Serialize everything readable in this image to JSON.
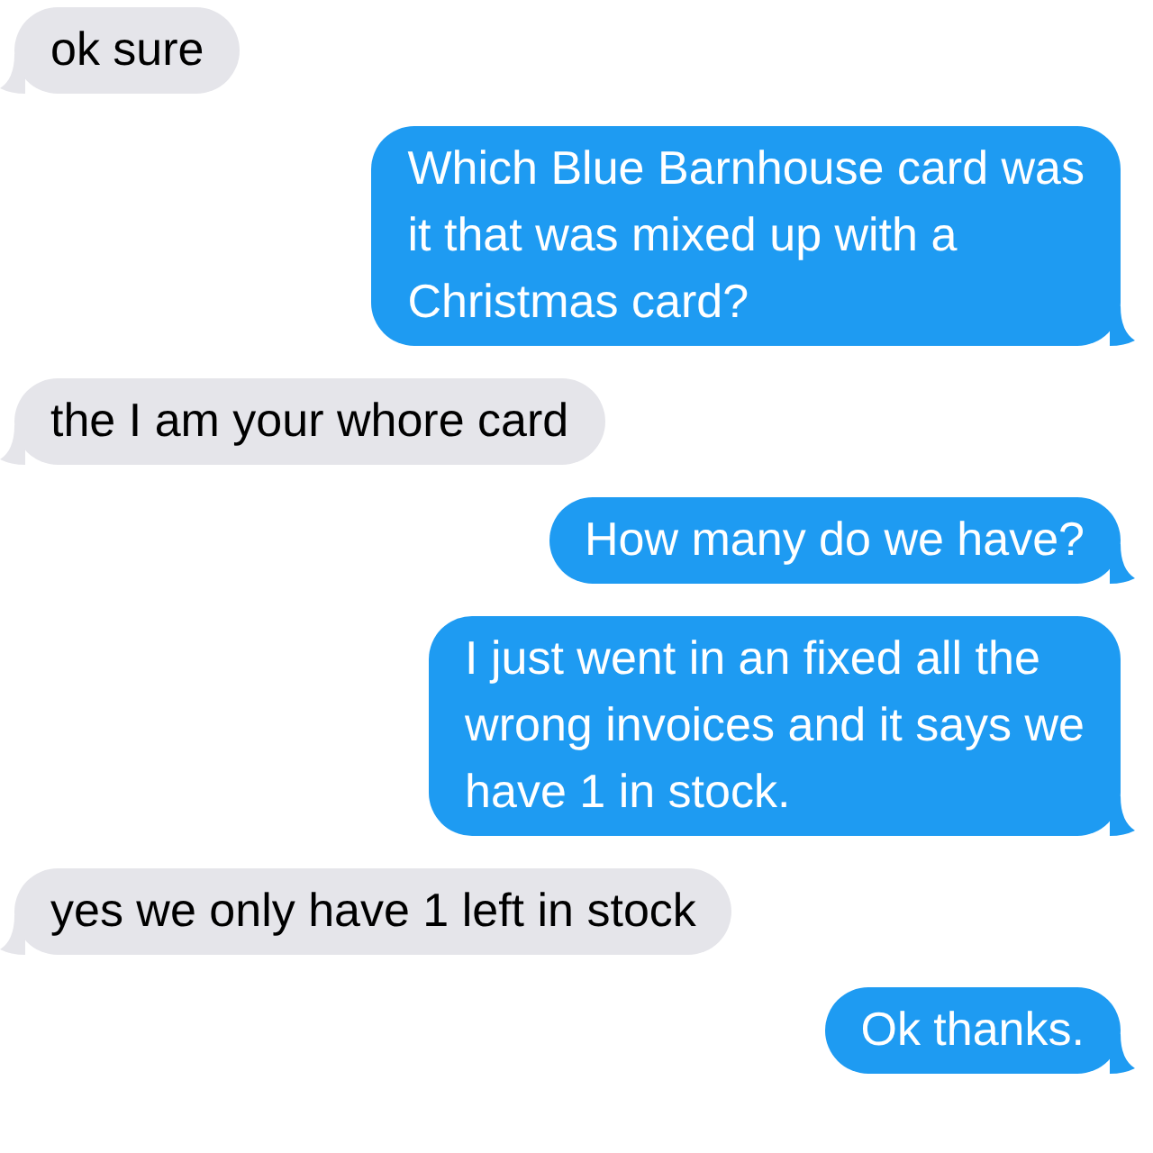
{
  "messages": [
    {
      "kind": "received",
      "lines": [
        "ok sure"
      ]
    },
    {
      "kind": "sent",
      "lines": [
        "Which Blue Barnhouse card was",
        "it that was mixed up with a",
        "Christmas card?"
      ]
    },
    {
      "kind": "received",
      "lines": [
        "the I am your whore card"
      ]
    },
    {
      "kind": "sent",
      "lines": [
        "How many do we have?"
      ]
    },
    {
      "kind": "sent",
      "lines": [
        "I just went in an fixed all the",
        "wrong invoices and it says we",
        "have 1 in stock."
      ]
    },
    {
      "kind": "received",
      "lines": [
        "yes we only have 1 left in stock"
      ]
    },
    {
      "kind": "sent",
      "lines": [
        "Ok thanks."
      ]
    }
  ]
}
